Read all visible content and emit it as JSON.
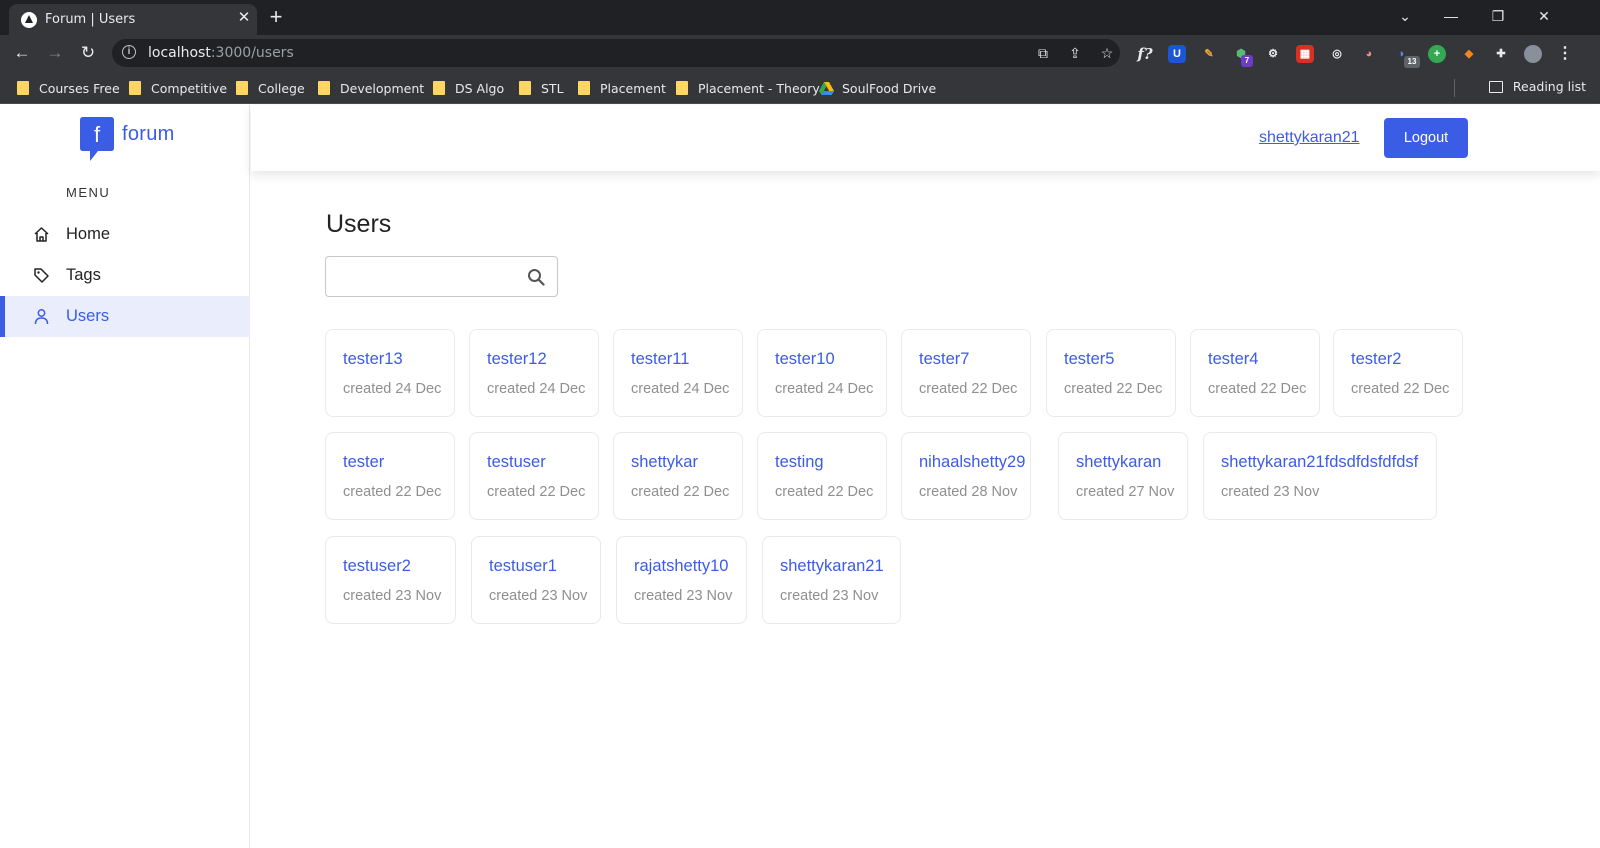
{
  "browser": {
    "tab_title": "Forum | Users",
    "url_host": "localhost",
    "url_path": ":3000/users",
    "bookmarks": [
      "Courses Free",
      "Competitive",
      "College",
      "Development",
      "DS Algo",
      "STL",
      "Placement",
      "Placement - Theory",
      "SoulFood Drive"
    ],
    "reading_list": "Reading list",
    "extension_badges": {
      "ext_a": "7",
      "ext_b": "13"
    }
  },
  "sidebar": {
    "logo_letter": "f",
    "logo_text": "forum",
    "menu_label": "MENU",
    "items": [
      {
        "label": "Home",
        "icon": "home-icon",
        "active": false
      },
      {
        "label": "Tags",
        "icon": "tag-icon",
        "active": false
      },
      {
        "label": "Users",
        "icon": "user-icon",
        "active": true
      }
    ]
  },
  "header": {
    "username": "shettykaran21",
    "logout_label": "Logout"
  },
  "main": {
    "title": "Users",
    "search": {
      "value": "",
      "placeholder": ""
    },
    "users": [
      {
        "name": "tester13",
        "created": "created 24 Dec"
      },
      {
        "name": "tester12",
        "created": "created 24 Dec"
      },
      {
        "name": "tester11",
        "created": "created 24 Dec"
      },
      {
        "name": "tester10",
        "created": "created 24 Dec"
      },
      {
        "name": "tester7",
        "created": "created 22 Dec"
      },
      {
        "name": "tester5",
        "created": "created 22 Dec"
      },
      {
        "name": "tester4",
        "created": "created 22 Dec"
      },
      {
        "name": "tester2",
        "created": "created 22 Dec"
      },
      {
        "name": "tester",
        "created": "created 22 Dec"
      },
      {
        "name": "testuser",
        "created": "created 22 Dec"
      },
      {
        "name": "shettykar",
        "created": "created 22 Dec"
      },
      {
        "name": "testing",
        "created": "created 22 Dec"
      },
      {
        "name": "nihaalshetty29",
        "created": "created 28 Nov"
      },
      {
        "name": "shettykaran",
        "created": "created 27 Nov"
      },
      {
        "name": "shettykaran21fdsdfdsfdfdsf",
        "created": "created 23 Nov"
      },
      {
        "name": "testuser2",
        "created": "created 23 Nov"
      },
      {
        "name": "testuser1",
        "created": "created 23 Nov"
      },
      {
        "name": "rajatshetty10",
        "created": "created 23 Nov"
      },
      {
        "name": "shettykaran21",
        "created": "created 23 Nov"
      }
    ]
  },
  "colors": {
    "accent": "#3b5ce4",
    "active_bg": "#eaedfc",
    "muted_text": "#8f8f8f"
  }
}
